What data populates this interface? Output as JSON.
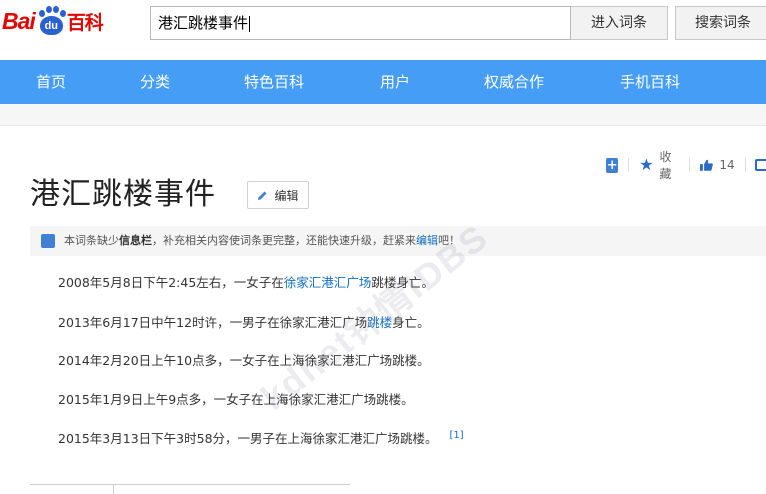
{
  "logo": {
    "bai": "Bai",
    "du": "du",
    "baike": "百科"
  },
  "search": {
    "value": "港汇跳楼事件"
  },
  "buttons": {
    "enter": "进入词条",
    "search": "搜索词条"
  },
  "nav": [
    "首页",
    "分类",
    "特色百科",
    "用户",
    "权威合作",
    "手机百科"
  ],
  "tools": {
    "collect": "收藏",
    "likes": "14"
  },
  "title": "港汇跳楼事件",
  "edit_label": "编辑",
  "notice": {
    "pre": "本词条缺少",
    "bold": "信息栏",
    "mid": "，补充相关内容使词条更完整，还能快速升级，赶紧来",
    "link": "编辑",
    "post": "吧！"
  },
  "paragraphs": [
    {
      "pre": "2008年5月8日下午2:45左右，一女子在",
      "link": "徐家汇港汇广场",
      "post": "跳楼身亡。"
    },
    {
      "pre": "2013年6月17日中午12时许，一男子在徐家汇港汇广场",
      "link": "跳楼",
      "post": "身亡。"
    },
    {
      "pre": "2014年2月20日上午10点多，一女子在上海徐家汇港汇广场跳楼。",
      "link": "",
      "post": ""
    },
    {
      "pre": "2015年1月9日上午9点多，一女子在上海徐家汇港汇广场跳楼。",
      "link": "",
      "post": ""
    },
    {
      "pre": "2015年3月13日下午3时58分，一男子在上海徐家汇港汇广场跳楼。",
      "link": "",
      "post": ""
    }
  ],
  "ref": "[1]",
  "watermark": "kdnet钟情IDBS",
  "colors": {
    "nav": "#459df5",
    "brand_red": "#e10601",
    "brand_blue": "#2a60d0",
    "link": "#136ec2"
  }
}
